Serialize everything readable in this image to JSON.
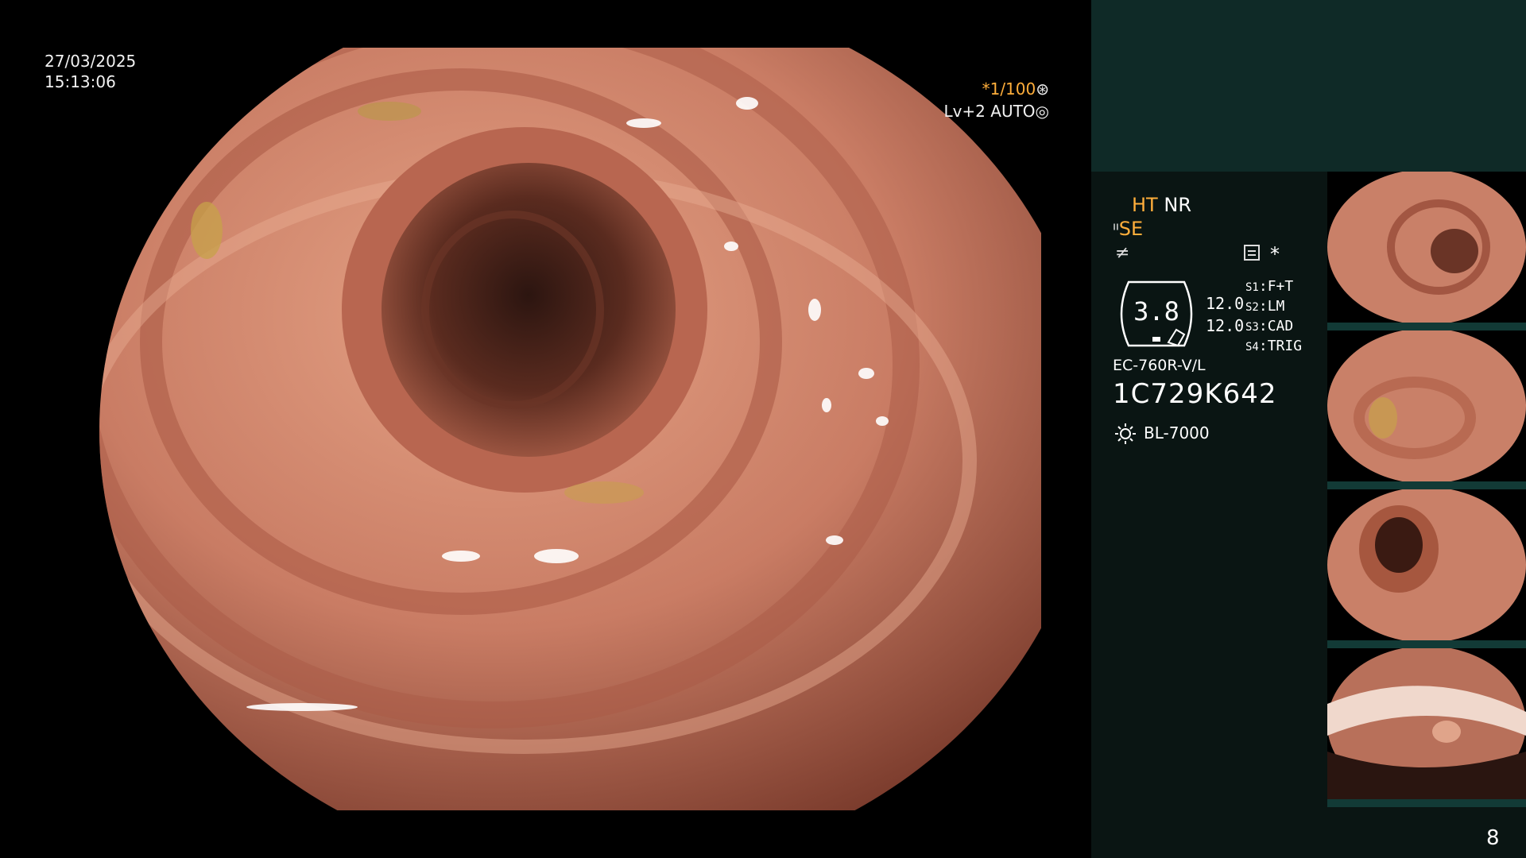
{
  "osd": {
    "date": "27/03/2025",
    "time": "15:13:06",
    "shutter": "*1/100",
    "shutter_icon": "aperture-icon",
    "level": "Lv+2 AUTO",
    "level_icon": "iris-icon"
  },
  "panel": {
    "mode_ht": "HT",
    "mode_nr": "NR",
    "mode_se": "SE",
    "se_icon": "scope-tip-icon",
    "rx_icon": "not-equal-icon",
    "grid_icon": "list-icon",
    "star": "*",
    "dial_value": "3.8",
    "value_a": "12.0",
    "value_b": "12.0",
    "switches": [
      {
        "key": "S1",
        "value": "F+T"
      },
      {
        "key": "S2",
        "value": "LM"
      },
      {
        "key": "S3",
        "value": "CAD"
      },
      {
        "key": "S4",
        "value": "TRIG"
      }
    ],
    "scope_model": "EC-760R-V/L",
    "scope_serial": "1C729K642",
    "light_icon": "sun-icon",
    "light_source": "BL-7000",
    "page_number": "8"
  },
  "colors": {
    "panel_top": "#0f2a27",
    "panel_main": "#0a1513",
    "accent_orange": "#ffae3b",
    "mucosa": "#c57b64"
  },
  "thumbnails": [
    {
      "name": "capture-1"
    },
    {
      "name": "capture-2"
    },
    {
      "name": "capture-3"
    },
    {
      "name": "capture-4"
    }
  ]
}
